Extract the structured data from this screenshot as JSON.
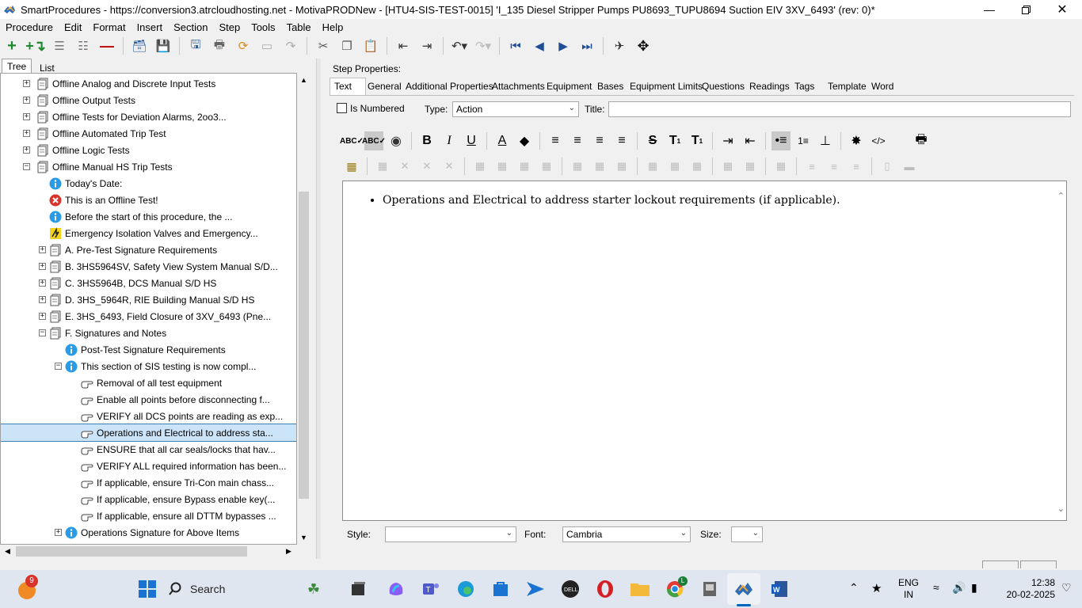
{
  "window": {
    "title": "SmartProcedures - https://conversion3.atrcloudhosting.net - MotivaPRODNew - [HTU4-SIS-TEST-0015] 'I_135 Diesel Stripper Pumps PU8693_TUPU8694 Suction EIV 3XV_6493' (rev: 0)*"
  },
  "menu": [
    "Procedure",
    "Edit",
    "Format",
    "Insert",
    "Section",
    "Step",
    "Tools",
    "Table",
    "Help"
  ],
  "left_tabs": [
    "Tree",
    "List"
  ],
  "tree": [
    {
      "label": "Offline Analog and Discrete Input Tests",
      "icon": "section-icon",
      "exp": "+",
      "level": 0
    },
    {
      "label": "Offline Output Tests",
      "icon": "section-icon",
      "exp": "+",
      "level": 0
    },
    {
      "label": "Offline Tests for Deviation Alarms, 2oo3...",
      "icon": "section-icon",
      "exp": "+",
      "level": 0
    },
    {
      "label": "Offline Automated Trip Test",
      "icon": "section-icon",
      "exp": "+",
      "level": 0
    },
    {
      "label": "Offline Logic Tests",
      "icon": "section-icon",
      "exp": "+",
      "level": 0
    },
    {
      "label": "Offline Manual HS Trip Tests",
      "icon": "section-icon",
      "exp": "−",
      "level": 0
    },
    {
      "label": "Today's Date:",
      "icon": "info-icon",
      "exp": "",
      "level": 1
    },
    {
      "label": "This is an Offline Test!",
      "icon": "error-icon",
      "exp": "",
      "level": 1
    },
    {
      "label": "Before the start of this procedure, the ...",
      "icon": "info-icon",
      "exp": "",
      "level": 1
    },
    {
      "label": "Emergency Isolation Valves and Emergency...",
      "icon": "warning-icon",
      "exp": "",
      "level": 1
    },
    {
      "label": "A. Pre-Test Signature Requirements",
      "icon": "section-icon",
      "exp": "+",
      "level": 1
    },
    {
      "label": "B. 3HS5964SV, Safety View System Manual S/D...",
      "icon": "section-icon",
      "exp": "+",
      "level": 1
    },
    {
      "label": "C. 3HS5964B, DCS Manual S/D HS",
      "icon": "section-icon",
      "exp": "+",
      "level": 1
    },
    {
      "label": "D. 3HS_5964R, RIE Building Manual S/D HS",
      "icon": "section-icon",
      "exp": "+",
      "level": 1
    },
    {
      "label": "E. 3HS_6493, Field Closure of 3XV_6493 (Pne...",
      "icon": "section-icon",
      "exp": "+",
      "level": 1
    },
    {
      "label": "F. Signatures and Notes",
      "icon": "section-icon",
      "exp": "−",
      "level": 1
    },
    {
      "label": "Post-Test Signature Requirements",
      "icon": "info-icon",
      "exp": "",
      "level": 2
    },
    {
      "label": "This section of SIS testing is now compl...",
      "icon": "info-icon",
      "exp": "−",
      "level": 2
    },
    {
      "label": "Removal of all test equipment",
      "icon": "hand-icon",
      "exp": "",
      "level": 3
    },
    {
      "label": "Enable all points before disconnecting f...",
      "icon": "hand-icon",
      "exp": "",
      "level": 3
    },
    {
      "label": "VERIFY all DCS points are reading as exp...",
      "icon": "hand-icon",
      "exp": "",
      "level": 3
    },
    {
      "label": "Operations and Electrical to address sta...",
      "icon": "hand-icon",
      "exp": "",
      "level": 3,
      "selected": true
    },
    {
      "label": "ENSURE that all car seals/locks that hav...",
      "icon": "hand-icon",
      "exp": "",
      "level": 3
    },
    {
      "label": "VERIFY ALL required information has been...",
      "icon": "hand-icon",
      "exp": "",
      "level": 3
    },
    {
      "label": "If applicable, ensure Tri-Con main chass...",
      "icon": "hand-icon",
      "exp": "",
      "level": 3
    },
    {
      "label": "If applicable, ensure Bypass enable key(...",
      "icon": "hand-icon",
      "exp": "",
      "level": 3
    },
    {
      "label": "If applicable, ensure all DTTM bypasses ...",
      "icon": "hand-icon",
      "exp": "",
      "level": 3
    },
    {
      "label": "Operations Signature for Above Items",
      "icon": "info-icon",
      "exp": "+",
      "level": 2
    }
  ],
  "step_properties": {
    "heading": "Step Properties:",
    "tabs": [
      "Text",
      "General",
      "Additional Properties",
      "Attachments",
      "Equipment",
      "Bases",
      "Equipment Limits",
      "Questions",
      "Readings",
      "Tags",
      "Template",
      "Word"
    ],
    "is_numbered_label": "Is Numbered",
    "is_numbered": false,
    "type_label": "Type:",
    "type_value": "Action",
    "title_label": "Title:",
    "title_value": ""
  },
  "editor": {
    "bullet_text": "Operations and Electrical to address starter lockout requirements (if applicable)."
  },
  "bottom": {
    "style_label": "Style:",
    "style_value": "",
    "font_label": "Font:",
    "font_value": "Cambria",
    "size_label": "Size:",
    "size_value": ""
  },
  "taskbar": {
    "search": "Search",
    "weather_badge": "9",
    "chrome_badge": "L",
    "lang_line1": "ENG",
    "lang_line2": "IN",
    "time": "12:38",
    "date": "20-02-2025"
  },
  "colors": {
    "selection": "#cce4f7",
    "accent": "#0067c0",
    "taskbar": "#dfe6ef"
  }
}
